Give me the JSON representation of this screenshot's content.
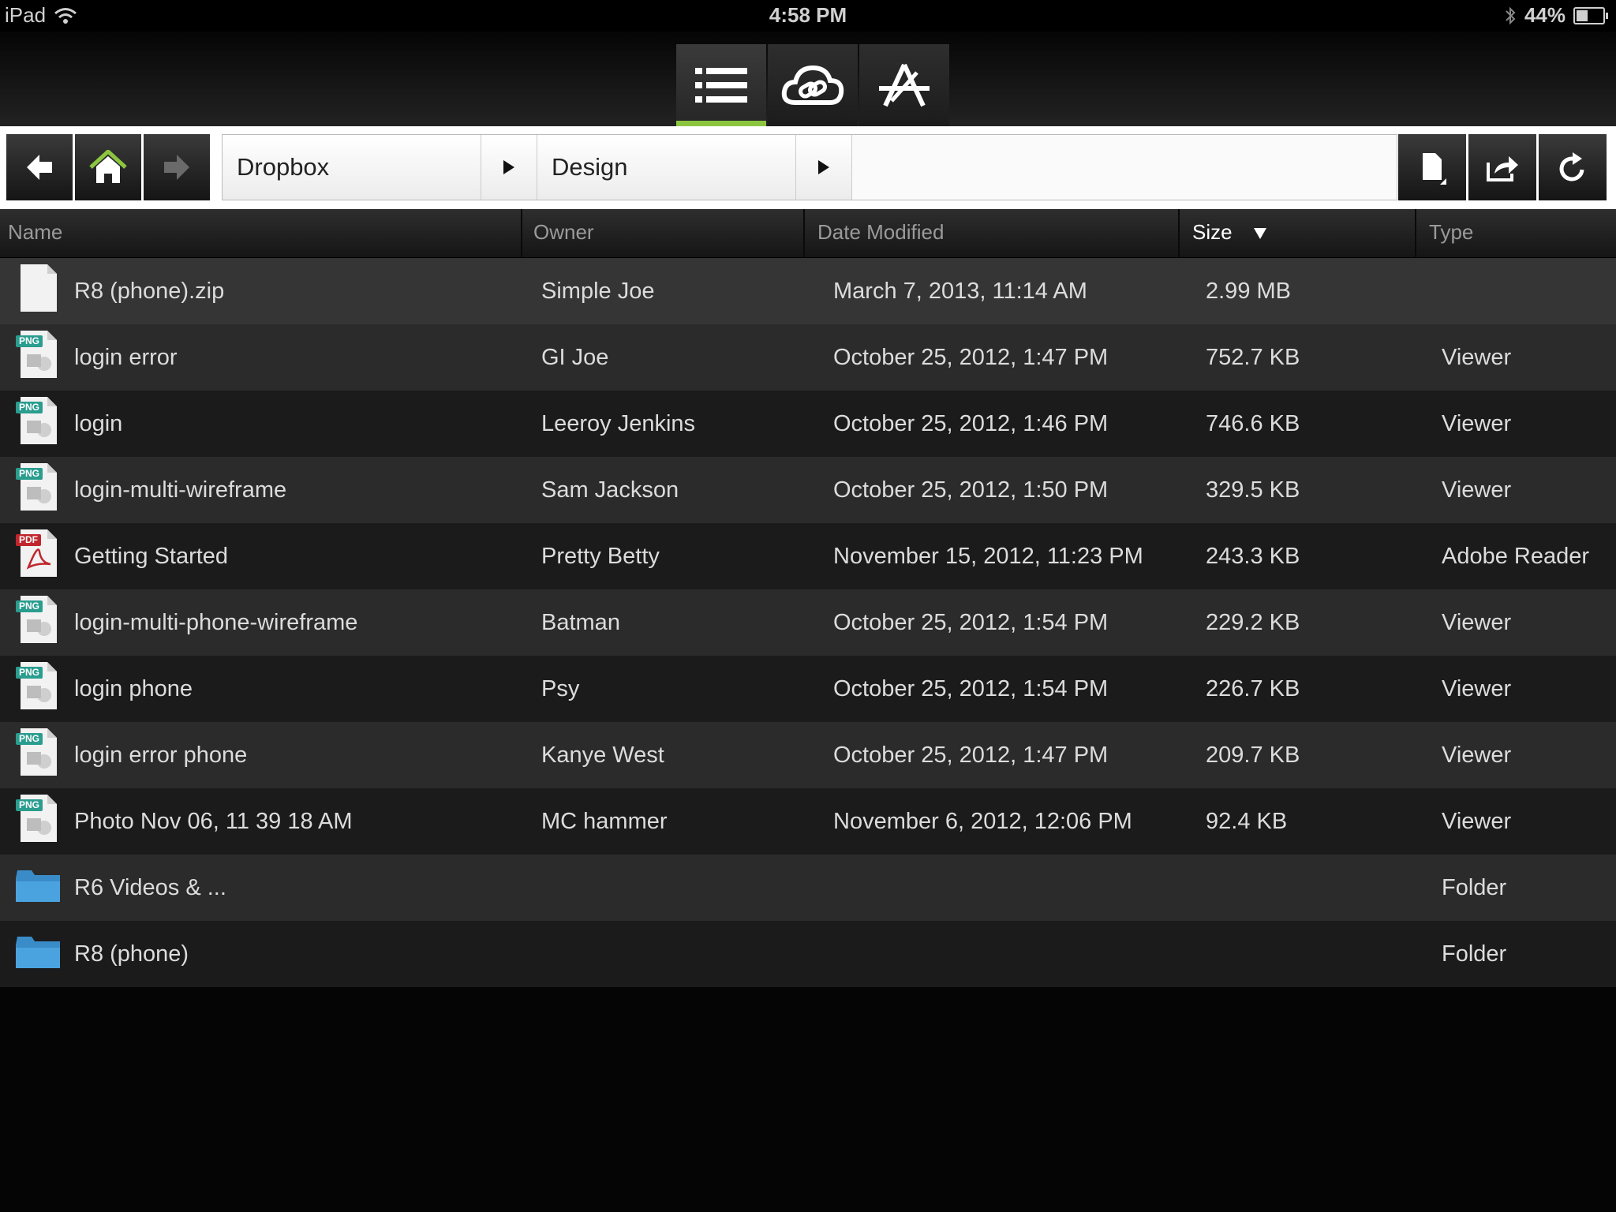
{
  "status_bar": {
    "device": "iPad",
    "time": "4:58 PM",
    "battery": "44%",
    "battery_level": 0.44
  },
  "top_tabs": [
    {
      "name": "list",
      "icon": "list-icon",
      "active": true
    },
    {
      "name": "cloud",
      "icon": "cloud-link-icon",
      "active": false
    },
    {
      "name": "app-store",
      "icon": "app-store-icon",
      "active": false
    }
  ],
  "toolbar": {
    "breadcrumbs": [
      "Dropbox",
      "Design"
    ]
  },
  "columns": {
    "name": "Name",
    "owner": "Owner",
    "date": "Date Modified",
    "size": "Size",
    "type": "Type"
  },
  "colors": {
    "accent": "#8cc63f",
    "png_badge": "#2a9d8f",
    "pdf_badge": "#c0262d",
    "folder": "#3a8cc8"
  },
  "files": [
    {
      "name": "R8 (phone).zip",
      "owner": "Simple Joe",
      "date": "March 7, 2013, 11:14 AM",
      "size": "2.99 MB",
      "type": "",
      "icon": "zip-file-icon",
      "badge": ""
    },
    {
      "name": "login error",
      "owner": "GI Joe",
      "date": "October 25, 2012, 1:47 PM",
      "size": "752.7 KB",
      "type": "Viewer",
      "icon": "png-file-icon",
      "badge": "PNG"
    },
    {
      "name": "login",
      "owner": "Leeroy Jenkins",
      "date": "October 25, 2012, 1:46 PM",
      "size": "746.6 KB",
      "type": "Viewer",
      "icon": "png-file-icon",
      "badge": "PNG"
    },
    {
      "name": "login-multi-wireframe",
      "owner": "Sam Jackson",
      "date": "October 25, 2012, 1:50 PM",
      "size": "329.5 KB",
      "type": "Viewer",
      "icon": "png-file-icon",
      "badge": "PNG"
    },
    {
      "name": "Getting Started",
      "owner": "Pretty Betty",
      "date": "November 15, 2012, 11:23 PM",
      "size": "243.3 KB",
      "type": "Adobe Reader",
      "icon": "pdf-file-icon",
      "badge": "PDF"
    },
    {
      "name": "login-multi-phone-wireframe",
      "owner": "Batman",
      "date": "October 25, 2012, 1:54 PM",
      "size": "229.2 KB",
      "type": "Viewer",
      "icon": "png-file-icon",
      "badge": "PNG"
    },
    {
      "name": "login phone",
      "owner": "Psy",
      "date": "October 25, 2012, 1:54 PM",
      "size": "226.7 KB",
      "type": "Viewer",
      "icon": "png-file-icon",
      "badge": "PNG"
    },
    {
      "name": "login error phone",
      "owner": "Kanye West",
      "date": "October 25, 2012, 1:47 PM",
      "size": "209.7 KB",
      "type": "Viewer",
      "icon": "png-file-icon",
      "badge": "PNG"
    },
    {
      "name": "Photo Nov 06, 11 39 18 AM",
      "owner": "MC hammer",
      "date": "November 6, 2012, 12:06 PM",
      "size": "92.4 KB",
      "type": "Viewer",
      "icon": "png-file-icon",
      "badge": "PNG"
    },
    {
      "name": "R6 Videos & ...",
      "owner": "",
      "date": "",
      "size": "",
      "type": "Folder",
      "icon": "folder-icon",
      "badge": ""
    },
    {
      "name": "R8 (phone)",
      "owner": "",
      "date": "",
      "size": "",
      "type": "Folder",
      "icon": "folder-icon",
      "badge": ""
    }
  ]
}
